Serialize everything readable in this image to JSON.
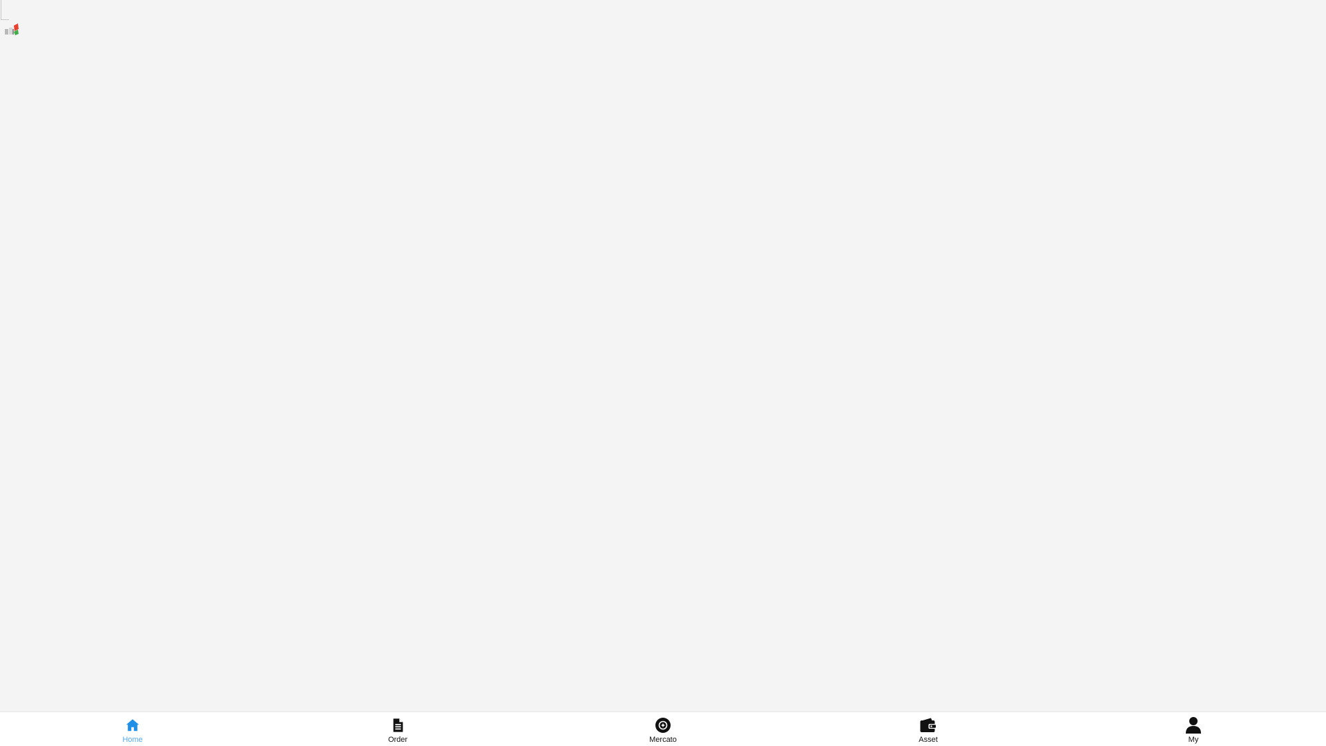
{
  "colors": {
    "background": "#f4f4f4",
    "tabbar_background": "#ffffff",
    "active": "#1f8fe8",
    "active_label": "#5aa7ea",
    "inactive": "#111111"
  },
  "broken_image": {
    "icon": "broken-image-icon"
  },
  "tabbar": {
    "active_index": 0,
    "items": [
      {
        "label": "Home",
        "icon": "home-icon",
        "active": true
      },
      {
        "label": "Order",
        "icon": "document-icon",
        "active": false
      },
      {
        "label": "Mercato",
        "icon": "market-icon",
        "active": false
      },
      {
        "label": "Asset",
        "icon": "wallet-icon",
        "active": false
      },
      {
        "label": "My",
        "icon": "user-icon",
        "active": false
      }
    ]
  }
}
